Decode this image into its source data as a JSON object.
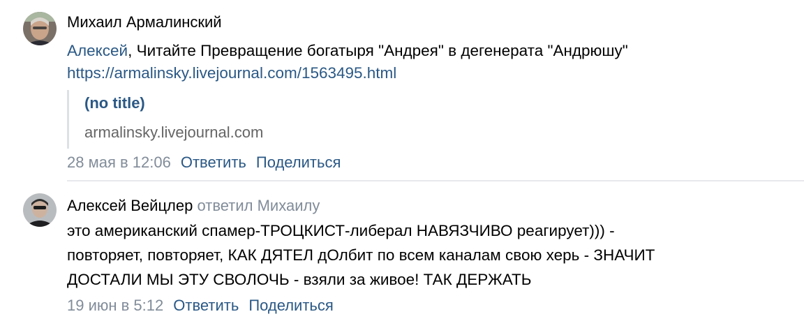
{
  "comments": [
    {
      "author": "Михаил Армалинский",
      "reply_mention": "Алексей",
      "text": ", Читайте Превращение богатыря \"Андрея\" в дегенерата \"Андрюшу\"",
      "url": "https://armalinsky.livejournal.com/1563495.html",
      "snippet": {
        "title": "(no title)",
        "domain": "armalinsky.livejournal.com"
      },
      "date": "28 мая в 12:06",
      "reply_label": "Ответить",
      "share_label": "Поделиться",
      "avatar_icon": "user-avatar"
    },
    {
      "author": "Алексей Вейцлер",
      "replied_prefix": "ответил",
      "replied_to": "Михаилу",
      "lines": [
        "это американский спамер-ТРОЦКИСТ-либерал НАВЯЗЧИВО реагирует))) -",
        "повторяет, повторяет, КАК ДЯТЕЛ дОлбит по всем каналам свою херь - ЗНАЧИТ",
        "ДОСТАЛИ МЫ ЭТУ СВОЛОЧЬ - взяли за живое! ТАК ДЕРЖАТЬ"
      ],
      "date": "19 июн в 5:12",
      "reply_label": "Ответить",
      "share_label": "Поделиться",
      "avatar_icon": "user-avatar"
    }
  ],
  "colors": {
    "link": "#2a5885",
    "meta_gray": "#818c99",
    "domain_gray": "#656565",
    "divider": "#e7e8ec"
  }
}
